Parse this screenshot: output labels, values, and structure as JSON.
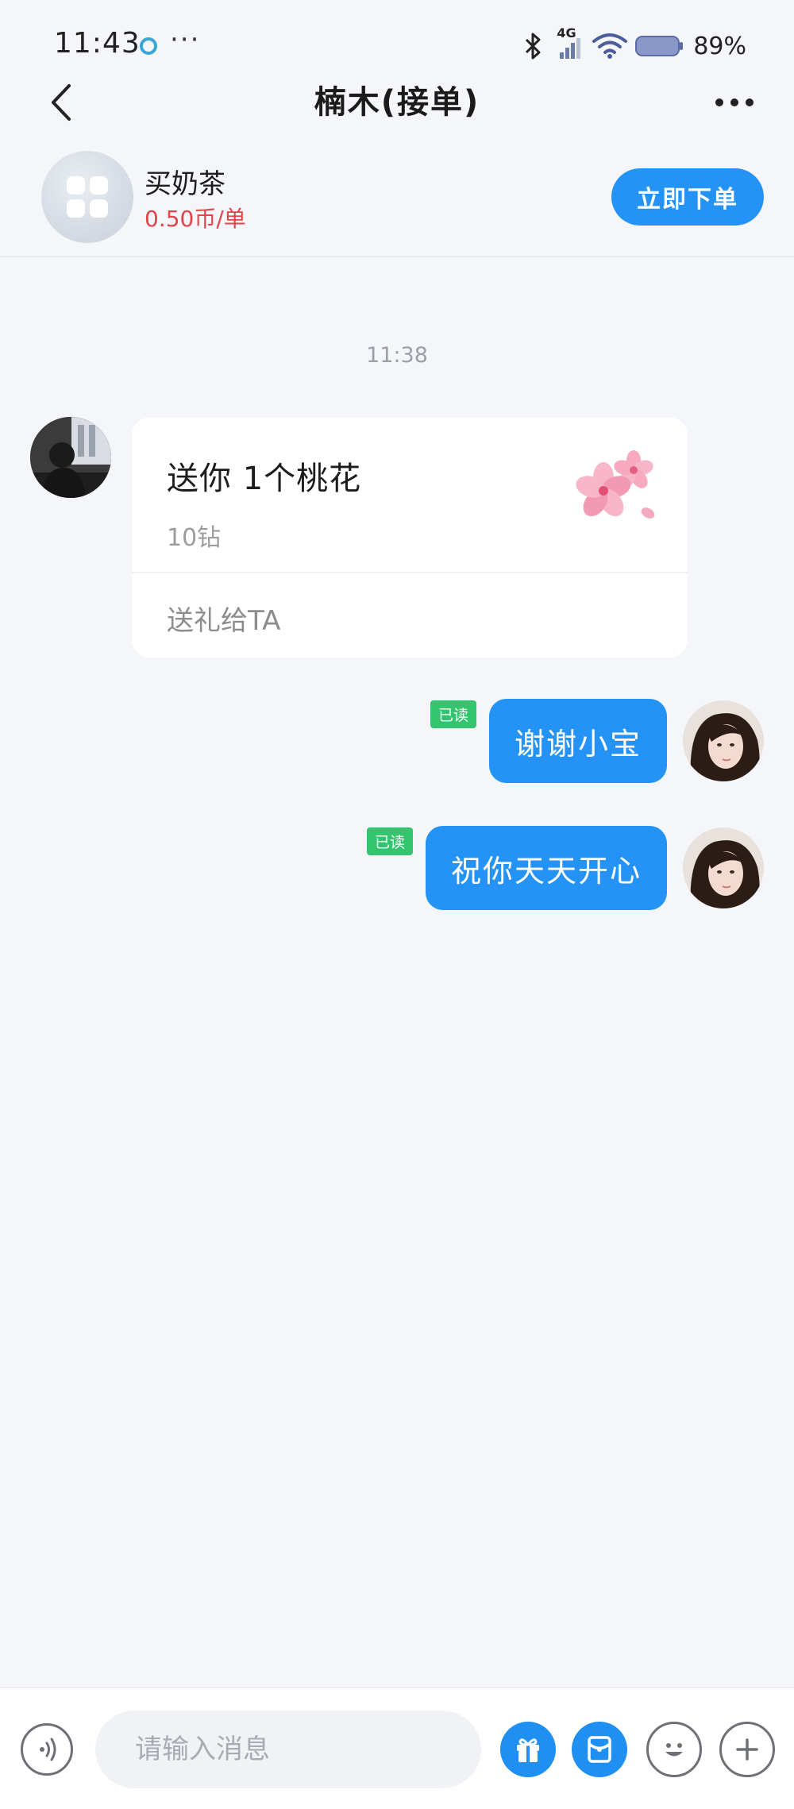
{
  "status": {
    "time": "11:43",
    "network": "4G",
    "battery": "89%"
  },
  "header": {
    "title": "楠木(接单)"
  },
  "order": {
    "service_name": "买奶茶",
    "price": "0.50币/单",
    "order_button": "立即下单"
  },
  "chat": {
    "time_divider": "11:38",
    "gift": {
      "title": "送你 1个桃花",
      "price": "10钻",
      "action": "送礼给TA"
    },
    "messages": [
      {
        "text": "谢谢小宝",
        "read": "已读"
      },
      {
        "text": "祝你天天开心",
        "read": "已读"
      }
    ]
  },
  "input": {
    "placeholder": "请输入消息"
  },
  "icons": {
    "back": "chevron-left-icon",
    "more": "more-dots-icon",
    "voice": "voice-icon",
    "gift": "gift-icon",
    "red_packet": "red-packet-icon",
    "emoji": "emoji-icon",
    "plus": "plus-icon"
  },
  "colors": {
    "accent": "#2593f5",
    "price": "#e0454a",
    "read_badge": "#33c46d",
    "background": "#f4f6f9"
  }
}
